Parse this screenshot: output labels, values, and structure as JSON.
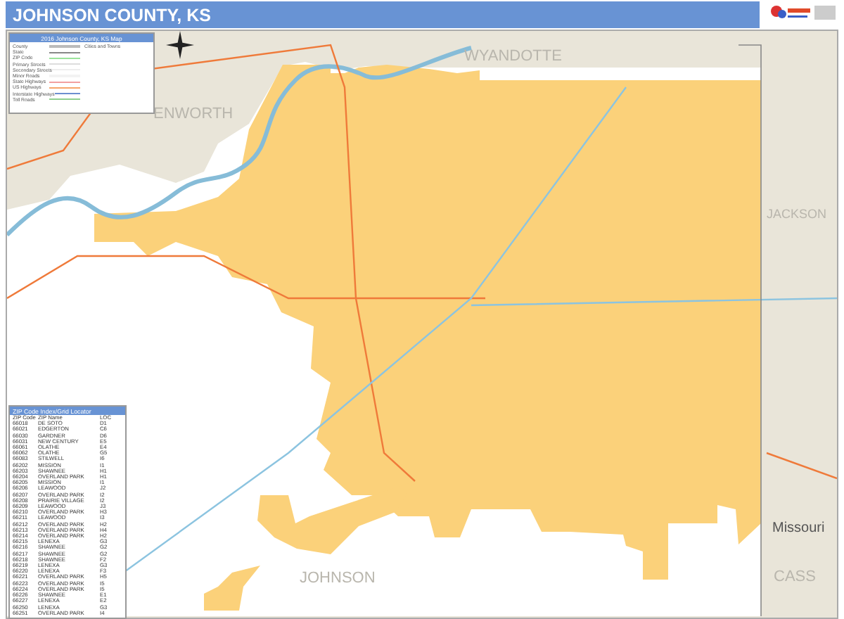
{
  "header": {
    "title": "JOHNSON COUNTY, KS"
  },
  "legend": {
    "title": "2016 Johnson County, KS Map",
    "cities_title": "Cities and Towns",
    "items": [
      {
        "label": "County"
      },
      {
        "label": "State"
      },
      {
        "label": "ZIP Code"
      },
      {
        "label": "Primary Streets"
      },
      {
        "label": "Secondary Streets"
      },
      {
        "label": "Minor Roads"
      },
      {
        "label": "State Highways"
      },
      {
        "label": "US Highways"
      },
      {
        "label": "Interstate Highways"
      },
      {
        "label": "Toll Roads"
      }
    ]
  },
  "map": {
    "counties": {
      "north_west": "ENWORTH",
      "north": "WYANDOTTE",
      "east": "JACKSON",
      "south_east": "CASS",
      "south": "JOHNSON"
    },
    "state": "Missouri"
  },
  "zip_index": {
    "title": "ZIP Code Index/Grid Locator",
    "columns": [
      "ZIP Code",
      "ZIP Name",
      "LOC"
    ],
    "rows": [
      {
        "zip": "66018",
        "name": "DE SOTO",
        "loc": "D1"
      },
      {
        "zip": "66021",
        "name": "EDGERTON",
        "loc": "C6"
      },
      {
        "zip": "66030",
        "name": "GARDNER",
        "loc": "D6"
      },
      {
        "zip": "66031",
        "name": "NEW CENTURY",
        "loc": "E5"
      },
      {
        "zip": "66061",
        "name": "OLATHE",
        "loc": "E4"
      },
      {
        "zip": "66062",
        "name": "OLATHE",
        "loc": "G5"
      },
      {
        "zip": "66083",
        "name": "STILWELL",
        "loc": "I6"
      },
      {
        "zip": "66202",
        "name": "MISSION",
        "loc": "I1"
      },
      {
        "zip": "66203",
        "name": "SHAWNEE",
        "loc": "H1"
      },
      {
        "zip": "66204",
        "name": "OVERLAND PARK",
        "loc": "H1"
      },
      {
        "zip": "66205",
        "name": "MISSION",
        "loc": "I1"
      },
      {
        "zip": "66206",
        "name": "LEAWOOD",
        "loc": "J2"
      },
      {
        "zip": "66207",
        "name": "OVERLAND PARK",
        "loc": "I2"
      },
      {
        "zip": "66208",
        "name": "PRAIRIE VILLAGE",
        "loc": "I2"
      },
      {
        "zip": "66209",
        "name": "LEAWOOD",
        "loc": "J3"
      },
      {
        "zip": "66210",
        "name": "OVERLAND PARK",
        "loc": "H3"
      },
      {
        "zip": "66211",
        "name": "LEAWOOD",
        "loc": "I3"
      },
      {
        "zip": "66212",
        "name": "OVERLAND PARK",
        "loc": "H2"
      },
      {
        "zip": "66213",
        "name": "OVERLAND PARK",
        "loc": "H4"
      },
      {
        "zip": "66214",
        "name": "OVERLAND PARK",
        "loc": "H2"
      },
      {
        "zip": "66215",
        "name": "LENEXA",
        "loc": "G3"
      },
      {
        "zip": "66216",
        "name": "SHAWNEE",
        "loc": "G2"
      },
      {
        "zip": "66217",
        "name": "SHAWNEE",
        "loc": "G2"
      },
      {
        "zip": "66218",
        "name": "SHAWNEE",
        "loc": "F2"
      },
      {
        "zip": "66219",
        "name": "LENEXA",
        "loc": "G3"
      },
      {
        "zip": "66220",
        "name": "LENEXA",
        "loc": "F3"
      },
      {
        "zip": "66221",
        "name": "OVERLAND PARK",
        "loc": "H5"
      },
      {
        "zip": "66223",
        "name": "OVERLAND PARK",
        "loc": "I5"
      },
      {
        "zip": "66224",
        "name": "OVERLAND PARK",
        "loc": "I5"
      },
      {
        "zip": "66226",
        "name": "SHAWNEE",
        "loc": "E1"
      },
      {
        "zip": "66227",
        "name": "LENEXA",
        "loc": "E2"
      },
      {
        "zip": "66250",
        "name": "LENEXA",
        "loc": "G3"
      },
      {
        "zip": "66251",
        "name": "OVERLAND PARK",
        "loc": "I4"
      }
    ]
  }
}
